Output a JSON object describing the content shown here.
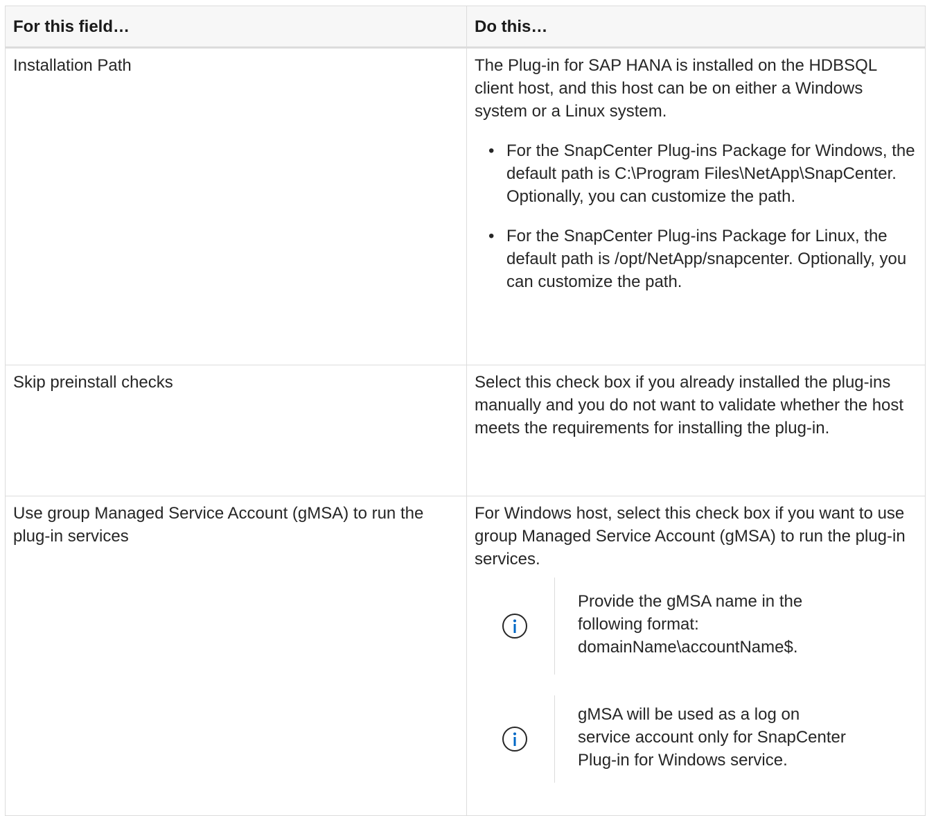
{
  "table": {
    "headers": {
      "field": "For this field…",
      "action": "Do this…"
    },
    "rows": [
      {
        "field": "Installation Path",
        "intro": "The Plug-in for SAP HANA is installed on the HDBSQL client host, and this host can be on either a Windows system or a Linux system.",
        "bullets": [
          "For the SnapCenter Plug-ins Package for Windows, the default path is C:\\Program Files\\NetApp\\SnapCenter. Optionally, you can customize the path.",
          "For the SnapCenter Plug-ins Package for Linux, the default path is /opt/NetApp/snapcenter. Optionally, you can customize the path."
        ]
      },
      {
        "field": "Skip preinstall checks",
        "text": "Select this check box if you already installed the plug-ins manually and you do not want to validate whether the host meets the requirements for installing the plug-in."
      },
      {
        "field": "Use group Managed Service Account (gMSA) to run the plug-in services",
        "text": "For Windows host, select this check box if you want to use group Managed Service Account (gMSA) to run the plug-in services.",
        "notes": [
          {
            "icon": "info-icon",
            "text": "Provide the gMSA name in the following format: domainName\\accountName$."
          },
          {
            "icon": "info-icon",
            "text": "gMSA will be used as a log on service account only for SnapCenter Plug-in for Windows service."
          }
        ]
      }
    ],
    "bullet_glyph": "•"
  },
  "colors": {
    "text": "#262626",
    "border": "#dcdcdc",
    "header_bg": "#f7f7f7",
    "info_icon": "#0067c5"
  }
}
